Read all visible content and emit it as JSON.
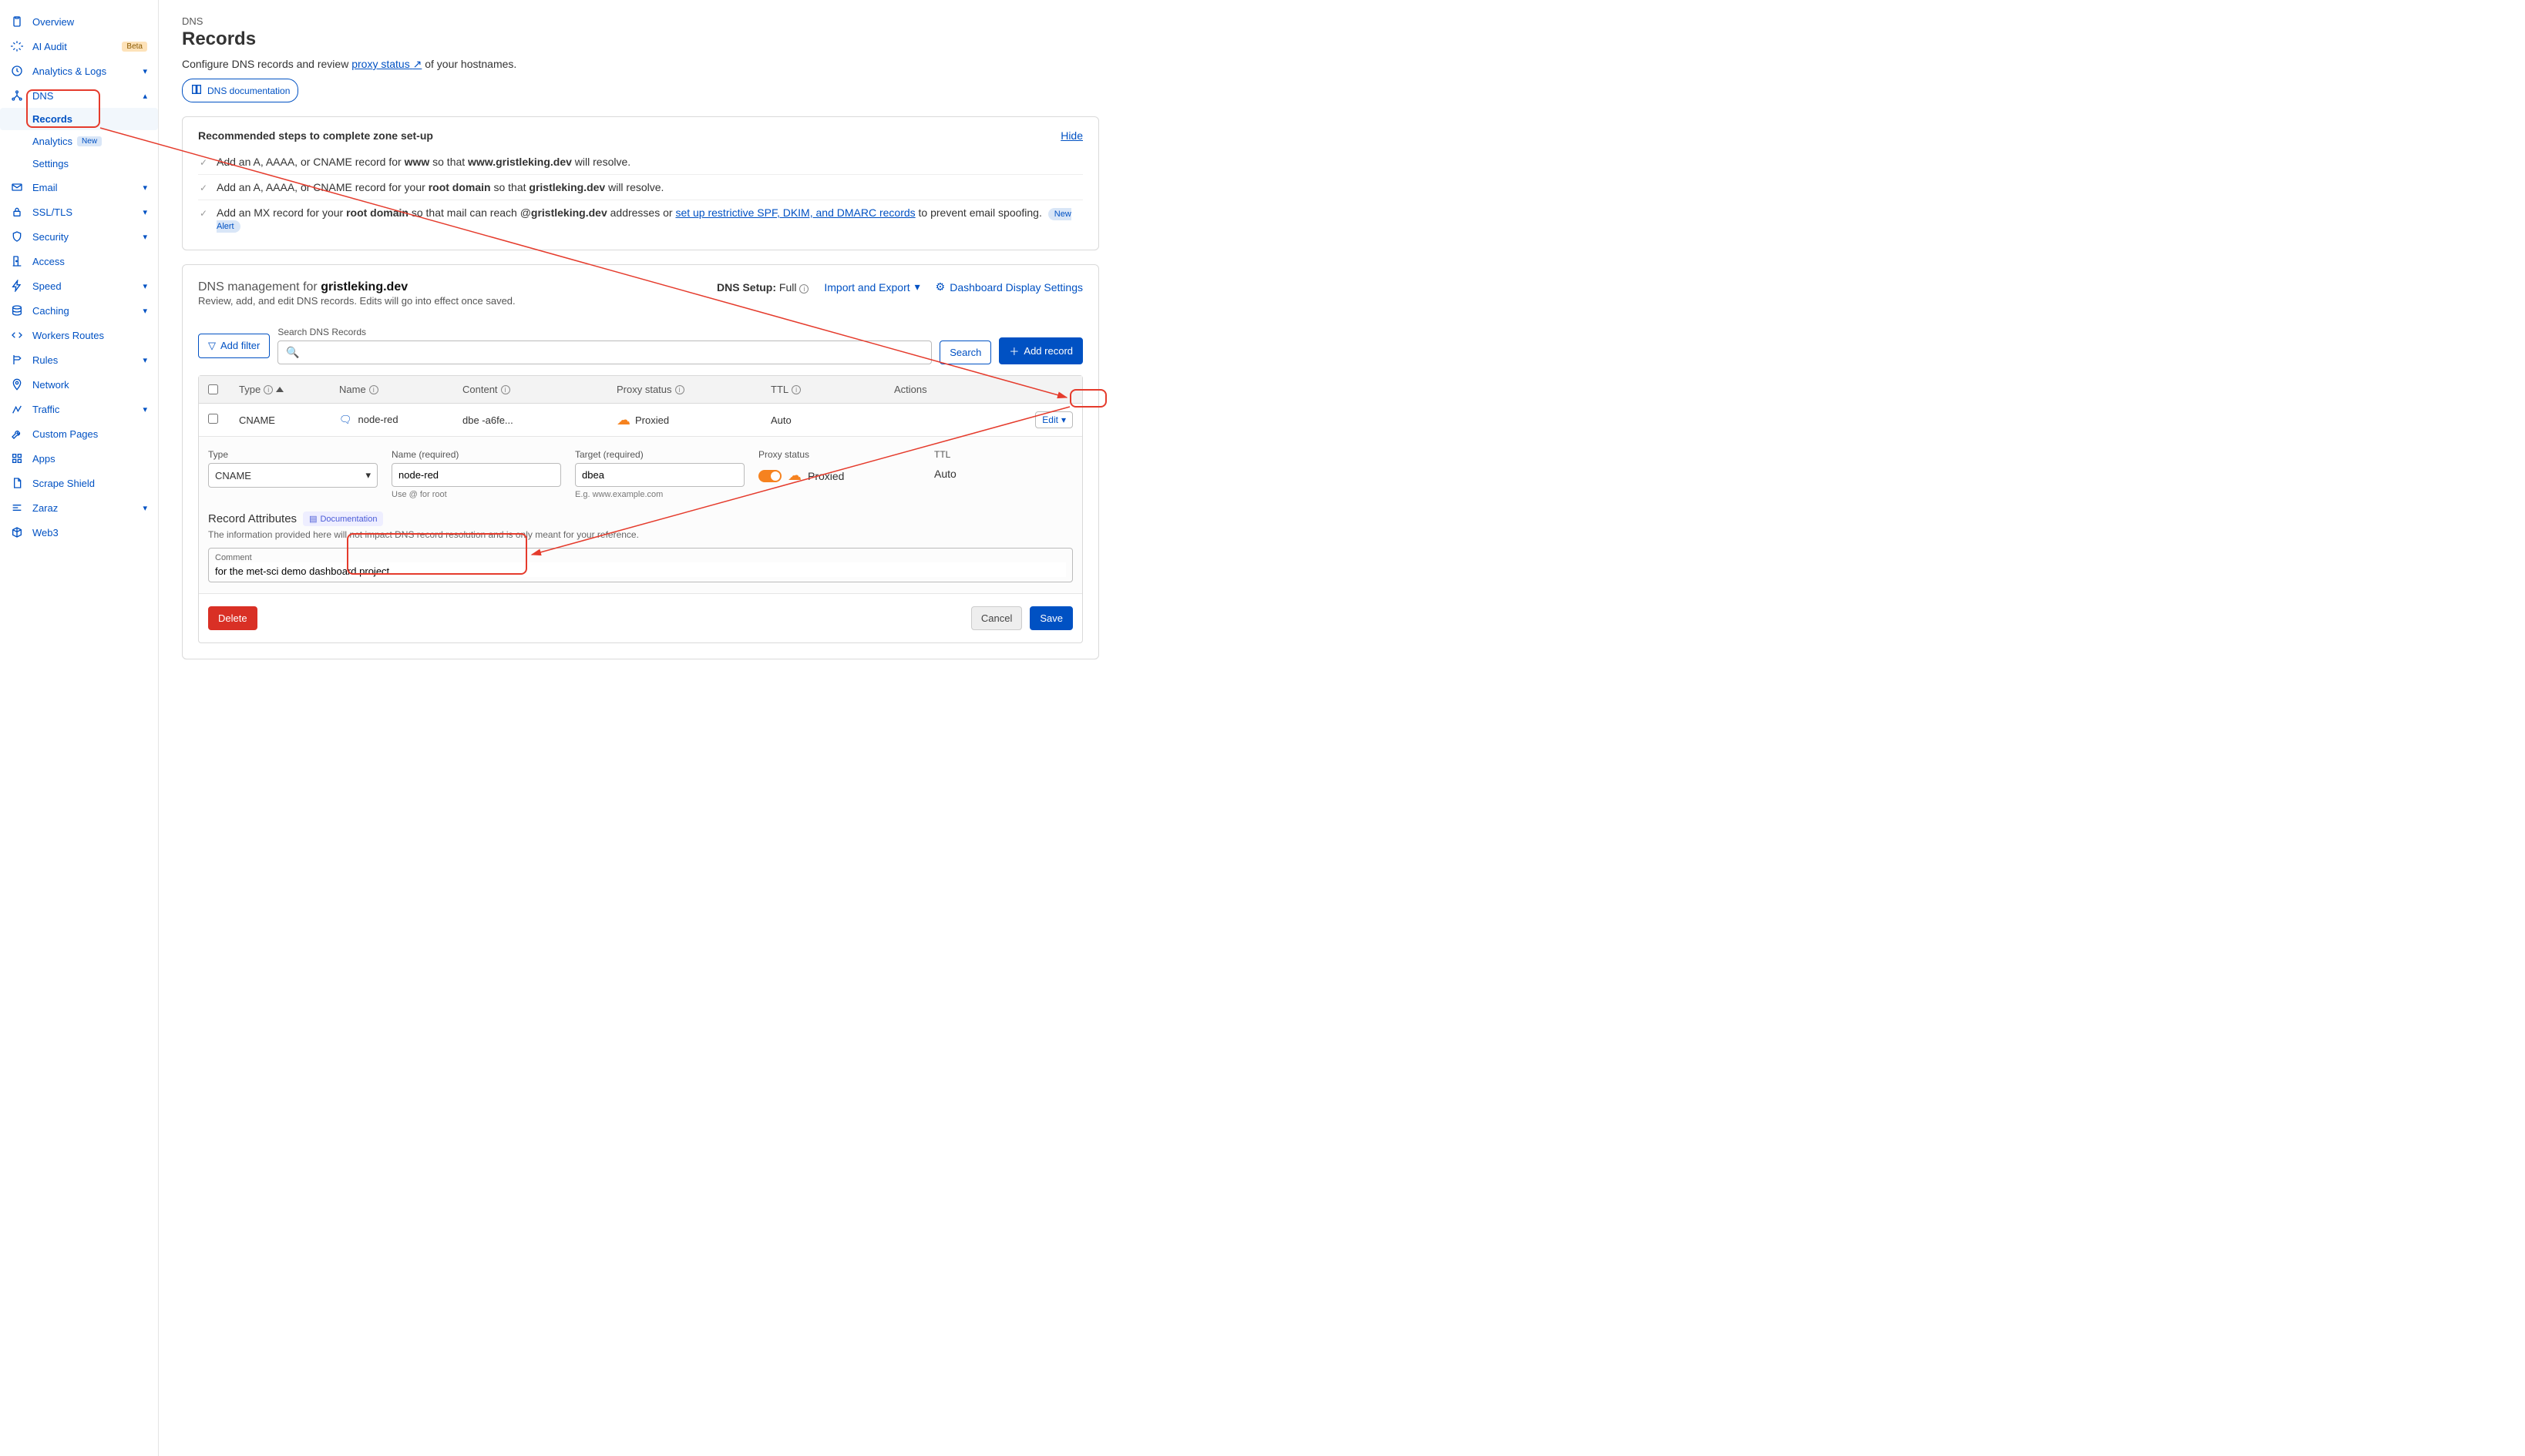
{
  "sidebar": {
    "items": [
      {
        "label": "Overview",
        "icon": "clipboard-icon"
      },
      {
        "label": "AI Audit",
        "icon": "sparkle-icon",
        "badge": "Beta"
      },
      {
        "label": "Analytics & Logs",
        "icon": "clock-icon",
        "expandable": true
      },
      {
        "label": "DNS",
        "icon": "network-icon",
        "expanded": true,
        "children": [
          {
            "label": "Records",
            "active": true
          },
          {
            "label": "Analytics",
            "badge": "New"
          },
          {
            "label": "Settings"
          }
        ]
      },
      {
        "label": "Email",
        "icon": "mail-icon",
        "expandable": true
      },
      {
        "label": "SSL/TLS",
        "icon": "lock-icon",
        "expandable": true
      },
      {
        "label": "Security",
        "icon": "shield-icon",
        "expandable": true
      },
      {
        "label": "Access",
        "icon": "door-icon"
      },
      {
        "label": "Speed",
        "icon": "bolt-icon",
        "expandable": true
      },
      {
        "label": "Caching",
        "icon": "stack-icon",
        "expandable": true
      },
      {
        "label": "Workers Routes",
        "icon": "code-icon"
      },
      {
        "label": "Rules",
        "icon": "rules-icon",
        "expandable": true
      },
      {
        "label": "Network",
        "icon": "pin-icon"
      },
      {
        "label": "Traffic",
        "icon": "traffic-icon",
        "expandable": true
      },
      {
        "label": "Custom Pages",
        "icon": "wrench-icon"
      },
      {
        "label": "Apps",
        "icon": "apps-icon"
      },
      {
        "label": "Scrape Shield",
        "icon": "doc-icon"
      },
      {
        "label": "Zaraz",
        "icon": "zaraz-icon",
        "expandable": true
      },
      {
        "label": "Web3",
        "icon": "web3-icon"
      }
    ]
  },
  "header": {
    "crumb": "DNS",
    "title": "Records",
    "sub_pre": "Configure DNS records and review ",
    "sub_link": "proxy status",
    "sub_post": " of your hostnames.",
    "doc_btn": "DNS documentation"
  },
  "recommended": {
    "title": "Recommended steps to complete zone set-up",
    "hide": "Hide",
    "items": [
      {
        "pre": "Add an A, AAAA, or CNAME record for ",
        "b1": "www",
        "mid": " so that ",
        "b2": "www.gristleking.dev",
        "post": " will resolve."
      },
      {
        "pre": "Add an A, AAAA, or CNAME record for your ",
        "b1": "root domain",
        "mid": " so that ",
        "b2": "gristleking.dev",
        "post": " will resolve."
      },
      {
        "pre": "Add an MX record for your ",
        "b1": "root domain",
        "mid": " so that mail can reach @",
        "b2": "gristleking.dev",
        "post": " addresses or ",
        "link": "set up restrictive SPF, DKIM, and DMARC records",
        "post2": " to prevent email spoofing.",
        "pill": "New Alert"
      }
    ]
  },
  "mgmt": {
    "title_pre": "DNS management for ",
    "domain": "gristleking.dev",
    "sub": "Review, add, and edit DNS records. Edits will go into effect once saved.",
    "setup_label": "DNS Setup:",
    "setup_value": "Full",
    "import": "Import and Export",
    "display_settings": "Dashboard Display Settings",
    "search_label": "Search DNS Records",
    "add_filter": "Add filter",
    "search_btn": "Search",
    "add_record": "Add record"
  },
  "table": {
    "cols": {
      "type": "Type",
      "name": "Name",
      "content": "Content",
      "proxy": "Proxy status",
      "ttl": "TTL",
      "actions": "Actions"
    },
    "row": {
      "type": "CNAME",
      "name": "node-red",
      "content": "dbe                    -a6fe...",
      "proxy": "Proxied",
      "ttl": "Auto",
      "edit": "Edit"
    }
  },
  "form": {
    "type_label": "Type",
    "type_value": "CNAME",
    "name_label": "Name (required)",
    "name_value": "node-red",
    "name_hint": "Use @ for root",
    "target_label": "Target (required)",
    "target_value": "dbea",
    "target_hint": "E.g. www.example.com",
    "proxy_label": "Proxy status",
    "proxy_value": "Proxied",
    "ttl_label": "TTL",
    "ttl_value": "Auto",
    "attr_title": "Record Attributes",
    "attr_doc": "Documentation",
    "attr_sub": "The information provided here will not impact DNS record resolution and is only meant for your reference.",
    "comment_label": "Comment",
    "comment_value": "for the met-sci demo dashboard project",
    "delete": "Delete",
    "cancel": "Cancel",
    "save": "Save"
  }
}
